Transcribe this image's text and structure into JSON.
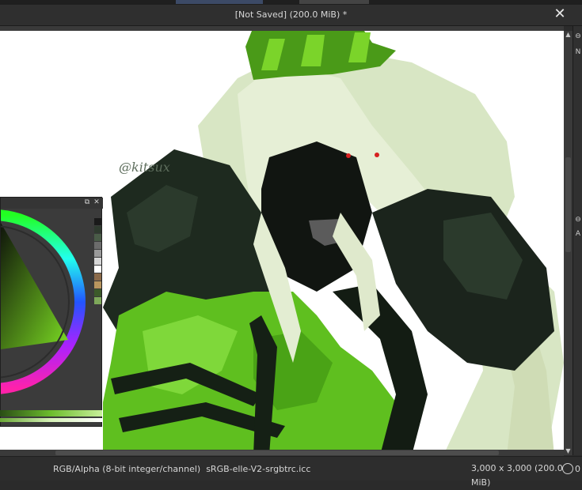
{
  "window": {
    "title": "[Not Saved]  (200.0 MiB) *",
    "close_glyph": "✕"
  },
  "canvas": {
    "signature_text": "@kitsux"
  },
  "status": {
    "color_space": "RGB/Alpha (8-bit integer/channel)  sRGB-elle-V2-srgbtrc.icc",
    "image_size": "3,000 x 3,000 (200.0 MiB)",
    "zoom_label": "0"
  },
  "right_dock": {
    "marks": [
      "N",
      "A"
    ]
  },
  "icons": {
    "close": "close-icon",
    "float": "float-panel-icon",
    "reset": "reset-icon",
    "zoom": "zoom-icon",
    "arrow_up": "scroll-up-icon",
    "arrow_down": "scroll-down-icon"
  },
  "colors": {
    "accent_green": "#5fbf1f",
    "dark_green": "#1e2a1f",
    "pale_green": "#d6e4c0",
    "background_dark": "#2b2b2b"
  },
  "palette": [
    "#1a1a1a",
    "#2f3b2f",
    "#4a5c48",
    "#6c6c6c",
    "#9a9a9a",
    "#d6d6d6",
    "#ffffff",
    "#8b6a4a",
    "#b8955e",
    "#3c5a2a",
    "#7ea85a"
  ]
}
